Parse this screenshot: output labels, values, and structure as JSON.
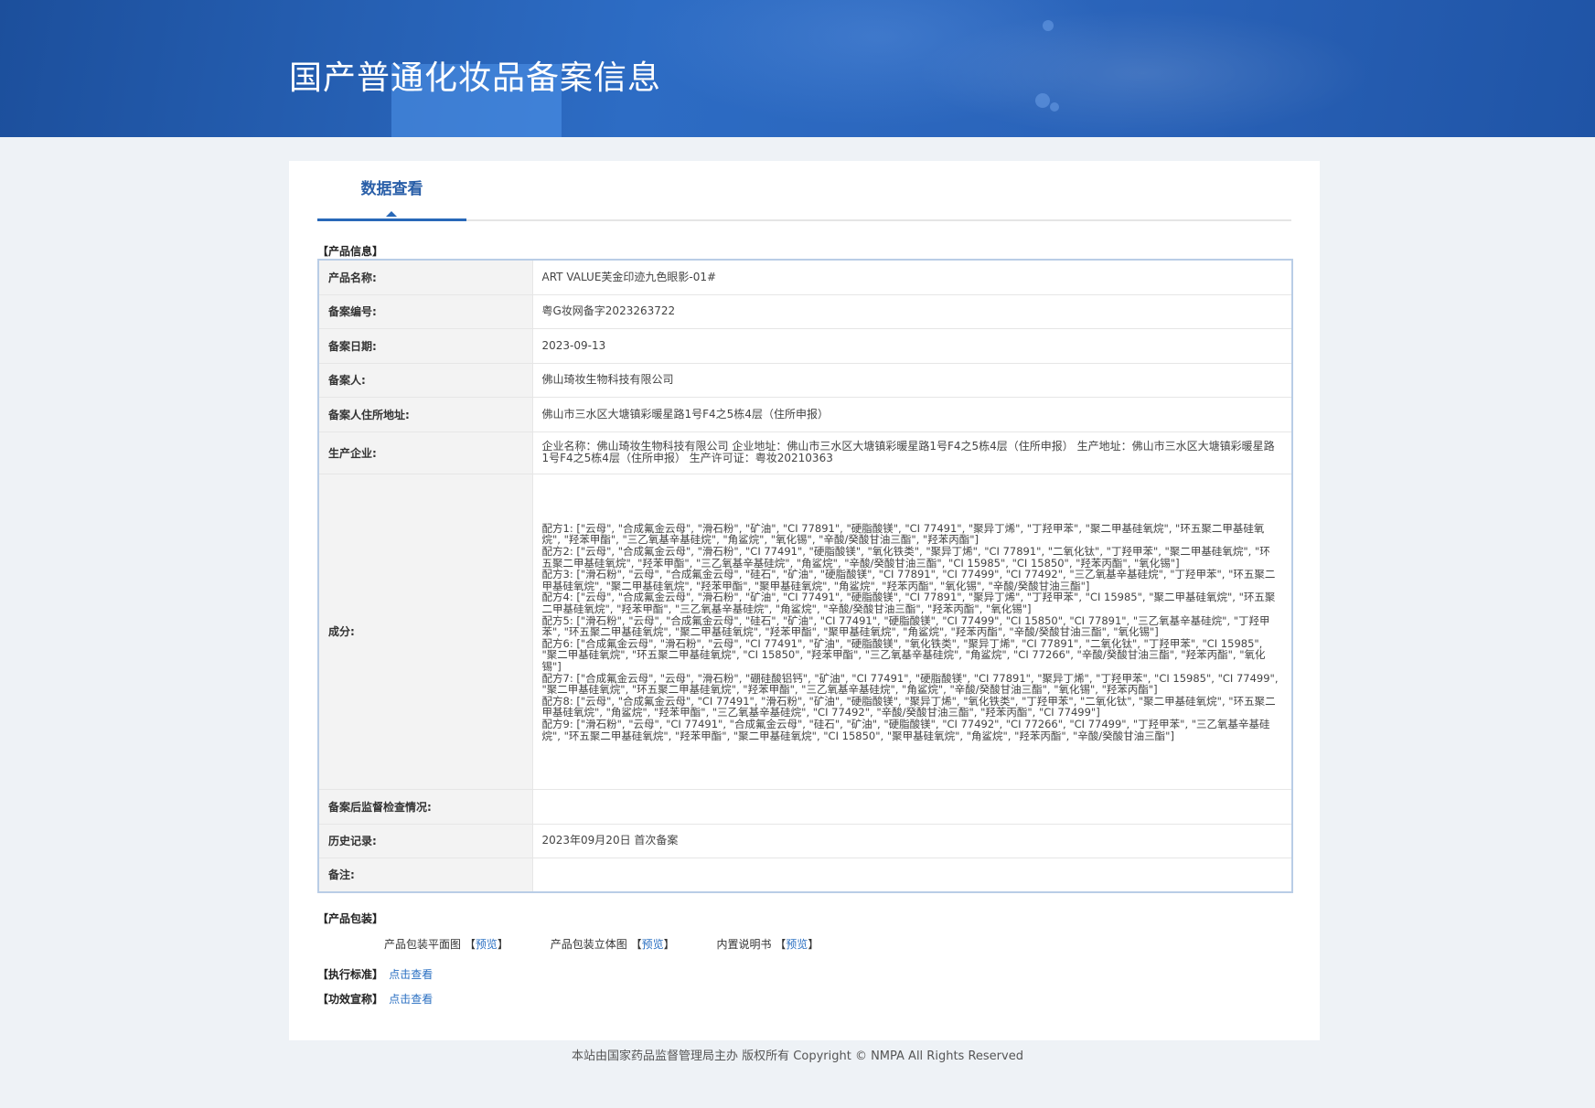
{
  "header": {
    "title": "国产普通化妆品备案信息"
  },
  "tabs": [
    {
      "label": "数据查看"
    }
  ],
  "product_info": {
    "section_title": "【产品信息】",
    "rows": [
      {
        "label": "产品名称:",
        "value": "ART VALUE芙金印迹九色眼影-01#"
      },
      {
        "label": "备案编号:",
        "value": "粤G妆网备字2023263722"
      },
      {
        "label": "备案日期:",
        "value": "2023-09-13"
      },
      {
        "label": "备案人:",
        "value": "佛山琦妆生物科技有限公司"
      },
      {
        "label": "备案人住所地址:",
        "value": "佛山市三水区大塘镇彩暖星路1号F4之5栋4层（住所申报）"
      },
      {
        "label": "生产企业:",
        "value": "企业名称：佛山琦妆生物科技有限公司 企业地址：佛山市三水区大塘镇彩暖星路1号F4之5栋4层（住所申报） 生产地址：佛山市三水区大塘镇彩暖星路1号F4之5栋4层（住所申报） 生产许可证：粤妆20210363"
      },
      {
        "label": "成分:",
        "lines": [
          "配方1: [\"云母\", \"合成氟金云母\", \"滑石粉\", \"矿油\", \"CI 77891\", \"硬脂酸镁\", \"CI 77491\", \"聚异丁烯\", \"丁羟甲苯\", \"聚二甲基硅氧烷\", \"环五聚二甲基硅氧烷\", \"羟苯甲酯\", \"三乙氧基辛基硅烷\", \"角鲨烷\", \"氧化锡\", \"辛酸/癸酸甘油三酯\", \"羟苯丙酯\"]",
          "配方2: [\"云母\", \"合成氟金云母\", \"滑石粉\", \"CI 77491\", \"硬脂酸镁\", \"氧化铁类\", \"聚异丁烯\", \"CI 77891\", \"二氧化钛\", \"丁羟甲苯\", \"聚二甲基硅氧烷\", \"环五聚二甲基硅氧烷\", \"羟苯甲酯\", \"三乙氧基辛基硅烷\", \"角鲨烷\", \"辛酸/癸酸甘油三酯\", \"CI 15985\", \"CI 15850\", \"羟苯丙酯\", \"氧化锡\"]",
          "配方3: [\"滑石粉\", \"云母\", \"合成氟金云母\", \"硅石\", \"矿油\", \"硬脂酸镁\", \"CI 77891\", \"CI 77499\", \"CI 77492\", \"三乙氧基辛基硅烷\", \"丁羟甲苯\", \"环五聚二甲基硅氧烷\", \"聚二甲基硅氧烷\", \"羟苯甲酯\", \"聚甲基硅氧烷\", \"角鲨烷\", \"羟苯丙酯\", \"氧化锡\", \"辛酸/癸酸甘油三酯\"]",
          "配方4: [\"云母\", \"合成氟金云母\", \"滑石粉\", \"矿油\", \"CI 77491\", \"硬脂酸镁\", \"CI 77891\", \"聚异丁烯\", \"丁羟甲苯\", \"CI 15985\", \"聚二甲基硅氧烷\", \"环五聚二甲基硅氧烷\", \"羟苯甲酯\", \"三乙氧基辛基硅烷\", \"角鲨烷\", \"辛酸/癸酸甘油三酯\", \"羟苯丙酯\", \"氧化锡\"]",
          "配方5: [\"滑石粉\", \"云母\", \"合成氟金云母\", \"硅石\", \"矿油\", \"CI 77491\", \"硬脂酸镁\", \"CI 77499\", \"CI 15850\", \"CI 77891\", \"三乙氧基辛基硅烷\", \"丁羟甲苯\", \"环五聚二甲基硅氧烷\", \"聚二甲基硅氧烷\", \"羟苯甲酯\", \"聚甲基硅氧烷\", \"角鲨烷\", \"羟苯丙酯\", \"辛酸/癸酸甘油三酯\", \"氧化锡\"]",
          "配方6: [\"合成氟金云母\", \"滑石粉\", \"云母\", \"CI 77491\", \"矿油\", \"硬脂酸镁\", \"氧化铁类\", \"聚异丁烯\", \"CI 77891\", \"二氧化钛\", \"丁羟甲苯\", \"CI 15985\", \"聚二甲基硅氧烷\", \"环五聚二甲基硅氧烷\", \"CI 15850\", \"羟苯甲酯\", \"三乙氧基辛基硅烷\", \"角鲨烷\", \"CI 77266\", \"辛酸/癸酸甘油三酯\", \"羟苯丙酯\", \"氧化锡\"]",
          "配方7: [\"合成氟金云母\", \"云母\", \"滑石粉\", \"硼硅酸铝钙\", \"矿油\", \"CI 77491\", \"硬脂酸镁\", \"CI 77891\", \"聚异丁烯\", \"丁羟甲苯\", \"CI 15985\", \"CI 77499\", \"聚二甲基硅氧烷\", \"环五聚二甲基硅氧烷\", \"羟苯甲酯\", \"三乙氧基辛基硅烷\", \"角鲨烷\", \"辛酸/癸酸甘油三酯\", \"氧化锡\", \"羟苯丙酯\"]",
          "配方8: [\"云母\", \"合成氟金云母\", \"CI 77491\", \"滑石粉\", \"矿油\", \"硬脂酸镁\", \"聚异丁烯\", \"氧化铁类\", \"丁羟甲苯\", \"二氧化钛\", \"聚二甲基硅氧烷\", \"环五聚二甲基硅氧烷\", \"角鲨烷\", \"羟苯甲酯\", \"三乙氧基辛基硅烷\", \"CI 77492\", \"辛酸/癸酸甘油三酯\", \"羟苯丙酯\", \"CI 77499\"]",
          "配方9: [\"滑石粉\", \"云母\", \"CI 77491\", \"合成氟金云母\", \"硅石\", \"矿油\", \"硬脂酸镁\", \"CI 77492\", \"CI 77266\", \"CI 77499\", \"丁羟甲苯\", \"三乙氧基辛基硅烷\", \"环五聚二甲基硅氧烷\", \"羟苯甲酯\", \"聚二甲基硅氧烷\", \"CI 15850\", \"聚甲基硅氧烷\", \"角鲨烷\", \"羟苯丙酯\", \"辛酸/癸酸甘油三酯\"]"
        ]
      },
      {
        "label": "备案后监督检查情况:",
        "value": ""
      },
      {
        "label": "历史记录:",
        "value": "2023年09月20日 首次备案"
      },
      {
        "label": "备注:",
        "value": ""
      }
    ]
  },
  "packaging": {
    "section_title": "【产品包装】",
    "items": [
      {
        "label": "产品包装平面图",
        "link": "预览"
      },
      {
        "label": "产品包装立体图",
        "link": "预览"
      },
      {
        "label": "内置说明书",
        "link": "预览"
      }
    ]
  },
  "standard": {
    "section_title": "【执行标准】",
    "link": "点击查看"
  },
  "efficacy": {
    "section_title": "【功效宣称】",
    "link": "点击查看"
  },
  "footer": {
    "text": "本站由国家药品监督管理局主办 版权所有 Copyright © NMPA All Rights Reserved"
  }
}
